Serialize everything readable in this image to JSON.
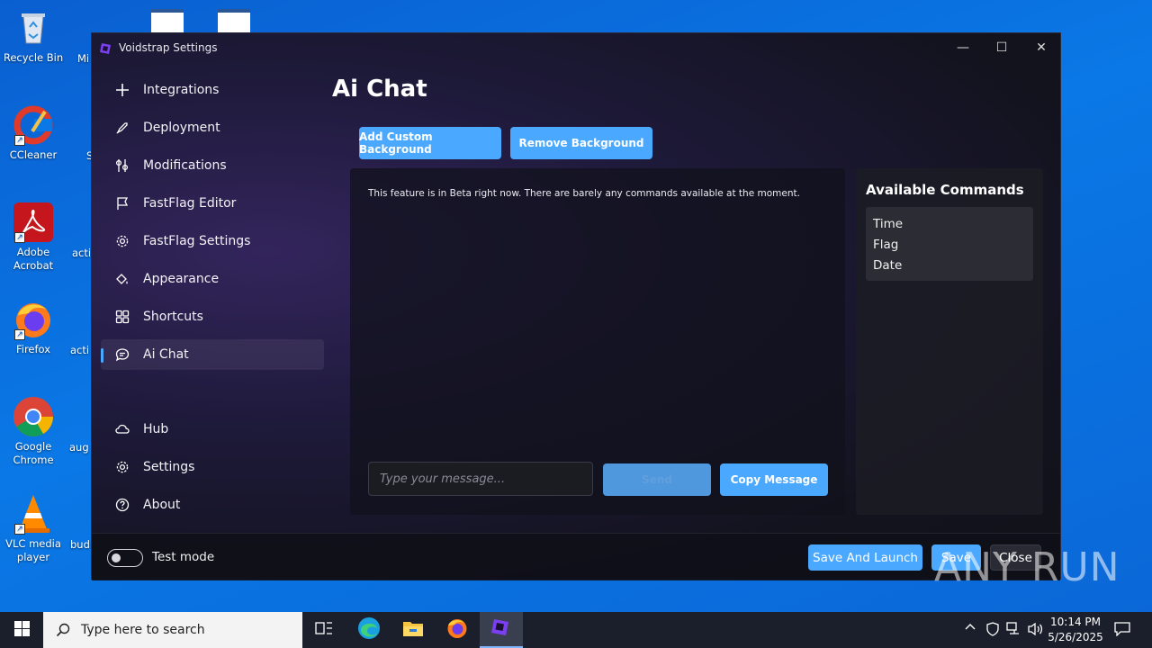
{
  "desktop": {
    "icons": [
      {
        "label": "Recycle Bin"
      },
      {
        "label": "CCleaner"
      },
      {
        "label": "Adobe Acrobat"
      },
      {
        "label": "Firefox"
      },
      {
        "label": "Google Chrome"
      },
      {
        "label": "VLC media player"
      }
    ],
    "peek_labels": [
      "Mi",
      "S",
      "acti",
      "acti",
      "aug",
      "bud"
    ]
  },
  "window": {
    "title": "Voidstrap Settings",
    "controls": {
      "minimize": "—",
      "maximize": "☐",
      "close": "✕"
    }
  },
  "sidebar": {
    "items": [
      {
        "label": "Integrations",
        "icon": "plus-icon"
      },
      {
        "label": "Deployment",
        "icon": "rocket-icon"
      },
      {
        "label": "Modifications",
        "icon": "wrench-icon"
      },
      {
        "label": "FastFlag Editor",
        "icon": "flag-icon"
      },
      {
        "label": "FastFlag Settings",
        "icon": "gear-icon"
      },
      {
        "label": "Appearance",
        "icon": "paint-bucket-icon"
      },
      {
        "label": "Shortcuts",
        "icon": "grid-icon"
      },
      {
        "label": "Ai Chat",
        "icon": "chat-icon",
        "active": true
      }
    ],
    "bottom_items": [
      {
        "label": "Hub",
        "icon": "cloud-icon"
      },
      {
        "label": "Settings",
        "icon": "gear-icon"
      },
      {
        "label": "About",
        "icon": "help-icon"
      }
    ]
  },
  "main": {
    "title": "Ai Chat",
    "add_background_label": "Add Custom Background",
    "remove_background_label": "Remove Background",
    "beta_note": "This feature is in Beta right now. There are barely any commands available at the moment.",
    "input_placeholder": "Type your message...",
    "send_label": "Send",
    "copy_label": "Copy Message"
  },
  "commands": {
    "title": "Available Commands",
    "items": [
      "Time",
      "Flag",
      "Date"
    ]
  },
  "footer": {
    "test_mode_label": "Test mode",
    "test_mode_on": false,
    "save_and_launch_label": "Save And Launch",
    "save_label": "Save",
    "close_label": "Close"
  },
  "taskbar": {
    "search_placeholder": "Type here to search",
    "time": "10:14 PM",
    "date": "5/26/2025"
  },
  "watermark": {
    "text": "ANY RUN"
  },
  "colors": {
    "accent": "#4aa8ff",
    "desktop": "#0a78e6",
    "taskbar": "#1b1f2b"
  }
}
